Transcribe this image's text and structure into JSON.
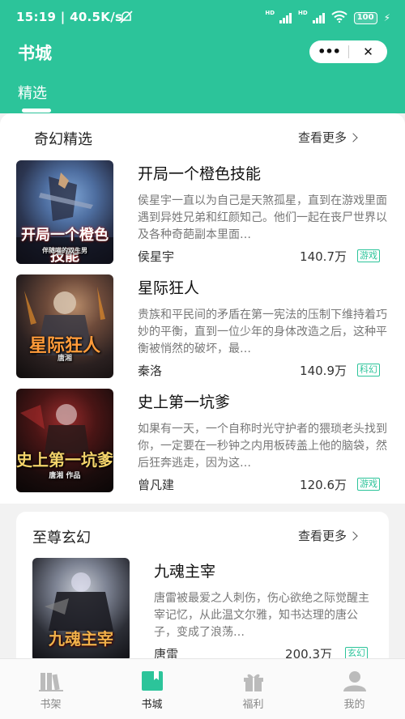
{
  "status": {
    "time": "15:19",
    "speed": "40.5K/s",
    "network1": "HD",
    "network2": "HD",
    "battery": "100"
  },
  "header": {
    "title": "书城",
    "capsule_more": "•••",
    "capsule_close": "✕"
  },
  "tabs": [
    {
      "label": "精选"
    }
  ],
  "sections": [
    {
      "title": "奇幻精选",
      "more": "查看更多",
      "books": [
        {
          "title": "开局一个橙色技能",
          "desc": "侯星宇一直以为自己是天煞孤星，直到在游戏里面遇到异姓兄弟和红颜知己。他们一起在丧尸世界以及各种奇葩副本里面…",
          "author": "侯星宇",
          "count": "140.7万",
          "tag": "游戏",
          "cover_text": "开局一个橙色技能",
          "cover_sub": "伴随喵的双生男"
        },
        {
          "title": "星际狂人",
          "desc": "贵族和平民间的矛盾在第一宪法的压制下维持着巧妙的平衡，直到一位少年的身体改造之后，这种平衡被悄然的破坏，最…",
          "author": "秦洛",
          "count": "140.9万",
          "tag": "科幻",
          "cover_text": "星际狂人",
          "cover_sub": "唐湘"
        },
        {
          "title": "史上第一坑爹",
          "desc": "如果有一天，一个自称时光守护者的猥琐老头找到你，一定要在一秒钟之内用板砖盖上他的脑袋，然后狂奔逃走，因为这…",
          "author": "曾凡建",
          "count": "120.6万",
          "tag": "游戏",
          "cover_text": "史上第一坑爹",
          "cover_sub": "唐湘 作品"
        }
      ]
    },
    {
      "title": "至尊玄幻",
      "more": "查看更多",
      "books": [
        {
          "title": "九魂主宰",
          "desc": "唐雷被最爱之人刺伤，伤心欲绝之际觉醒主宰记忆，从此温文尔雅，知书达理的唐公子，变成了浪荡…",
          "author": "唐雷",
          "count": "200.3万",
          "tag": "玄幻",
          "cover_text": "九魂主宰"
        }
      ]
    }
  ],
  "tabbar": [
    {
      "label": "书架",
      "icon": "bookshelf-icon"
    },
    {
      "label": "书城",
      "icon": "bookstore-icon"
    },
    {
      "label": "福利",
      "icon": "gift-icon"
    },
    {
      "label": "我的",
      "icon": "user-icon"
    }
  ],
  "colors": {
    "accent": "#2cc49a",
    "tag": "#2cc49a"
  }
}
